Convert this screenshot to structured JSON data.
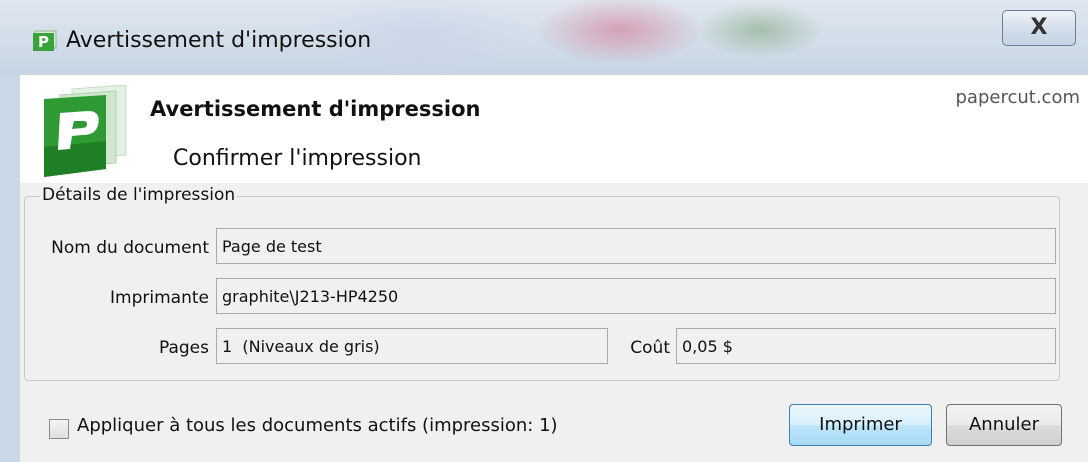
{
  "window": {
    "title": "Avertissement d'impression",
    "close_label": "X"
  },
  "header": {
    "title": "Avertissement d'impression",
    "subtitle": "Confirmer l'impression",
    "link": "papercut.com"
  },
  "details": {
    "legend": "Détails de l'impression",
    "document_label": "Nom du document",
    "document_value": "Page de test",
    "printer_label": "Imprimante",
    "printer_value": "graphite\\J213-HP4250",
    "pages_label": "Pages",
    "pages_value": "1  (Niveaux de gris)",
    "cost_label": "Coût",
    "cost_value": "0,05 $"
  },
  "footer": {
    "apply_all_label": "Appliquer à tous les documents actifs (impression: 1)",
    "apply_all_checked": false,
    "print_button": "Imprimer",
    "cancel_button": "Annuler"
  },
  "icons": {
    "app": "papercut-logo-icon",
    "close": "close-icon"
  },
  "colors": {
    "logo_green": "#3a9c3a",
    "primary_button_border": "#3c7fb1"
  }
}
